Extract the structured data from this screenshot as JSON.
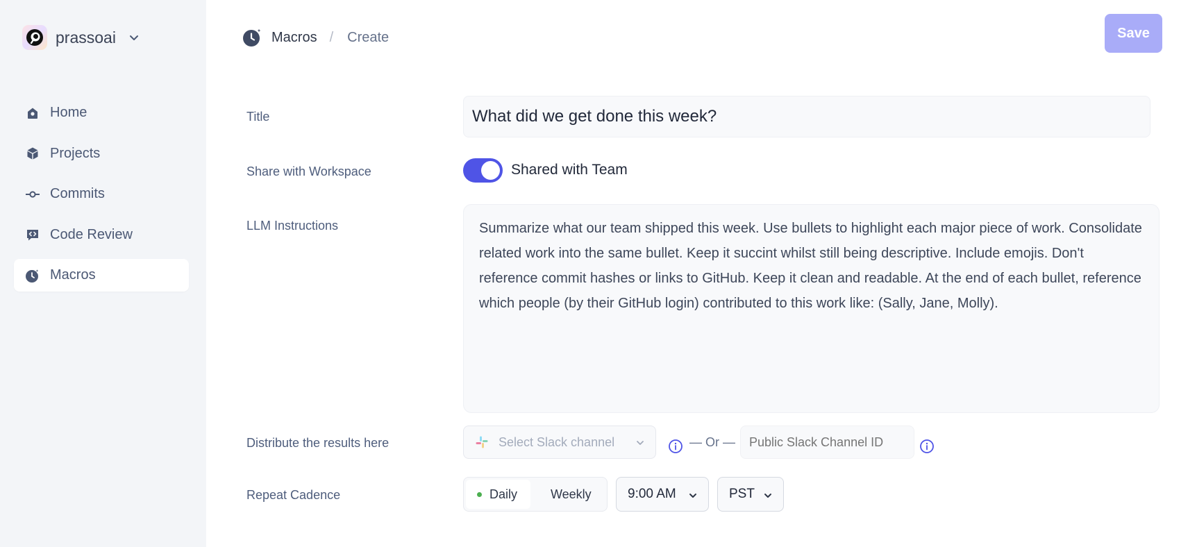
{
  "sidebar": {
    "workspace_name": "prassoai",
    "items": [
      {
        "label": "Home",
        "icon": "home-icon",
        "active": false
      },
      {
        "label": "Projects",
        "icon": "cube-icon",
        "active": false
      },
      {
        "label": "Commits",
        "icon": "commit-icon",
        "active": false
      },
      {
        "label": "Code Review",
        "icon": "code-review-icon",
        "active": false
      },
      {
        "label": "Macros",
        "icon": "macros-icon",
        "active": true
      }
    ]
  },
  "header": {
    "breadcrumb_section": "Macros",
    "breadcrumb_separator": "/",
    "breadcrumb_page": "Create",
    "save_label": "Save"
  },
  "form": {
    "title_label": "Title",
    "title_value": "What did we get done this week?",
    "share_label": "Share with Workspace",
    "share_toggle_on": true,
    "share_status": "Shared with Team",
    "llm_label": "LLM Instructions",
    "llm_value": "Summarize what our team shipped this week. Use bullets to highlight each major piece of work. Consolidate related work into the same bullet. Keep it succint whilst still being descriptive. Include emojis. Don't reference commit hashes or links to GitHub. Keep it clean and readable. At the end of each bullet, reference which people (by their GitHub login) contributed to this work like: (Sally, Jane, Molly).",
    "distribute_label": "Distribute the results here",
    "slack_select_placeholder": "Select Slack channel",
    "or_text": "— Or —",
    "channel_id_placeholder": "Public Slack Channel ID",
    "cadence_label": "Repeat Cadence",
    "cadence_options": [
      "Daily",
      "Weekly"
    ],
    "cadence_selected": "Daily",
    "time_value": "9:00 AM",
    "timezone_value": "PST"
  },
  "colors": {
    "accent": "#4f54e6",
    "save_disabled": "#a9acf8",
    "sidebar_bg": "#f3f5f8",
    "status_dot": "#4caf50"
  }
}
